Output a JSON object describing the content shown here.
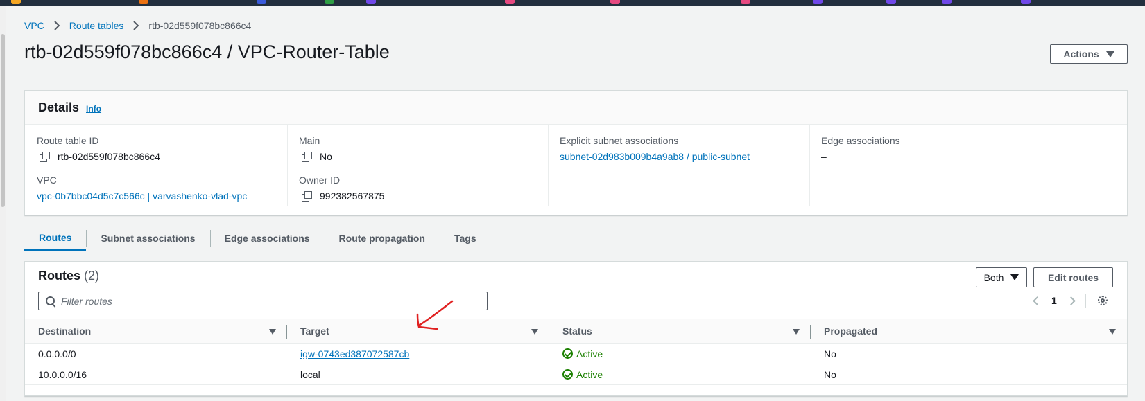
{
  "breadcrumb": {
    "vpc": "VPC",
    "route_tables": "Route tables",
    "current": "rtb-02d559f078bc866c4"
  },
  "page": {
    "title": "rtb-02d559f078bc866c4 / VPC-Router-Table",
    "actions_label": "Actions"
  },
  "details": {
    "heading": "Details",
    "info": "Info",
    "route_table_id_label": "Route table ID",
    "route_table_id": "rtb-02d559f078bc866c4",
    "vpc_label": "VPC",
    "vpc": "vpc-0b7bbc04d5c7c566c | varvashenko-vlad-vpc",
    "main_label": "Main",
    "main": "No",
    "owner_label": "Owner ID",
    "owner": "992382567875",
    "explicit_label": "Explicit subnet associations",
    "explicit": "subnet-02d983b009b4a9ab8 / public-subnet",
    "edge_label": "Edge associations",
    "edge": "–"
  },
  "tabs": [
    "Routes",
    "Subnet associations",
    "Edge associations",
    "Route propagation",
    "Tags"
  ],
  "routes": {
    "title": "Routes",
    "count": "(2)",
    "both_label": "Both",
    "edit_label": "Edit routes",
    "filter_placeholder": "Filter routes",
    "page_number": "1",
    "columns": [
      "Destination",
      "Target",
      "Status",
      "Propagated"
    ],
    "rows": [
      {
        "destination": "0.0.0.0/0",
        "target": "igw-0743ed387072587cb",
        "status": "Active",
        "propagated": "No"
      },
      {
        "destination": "10.0.0.0/16",
        "target": "local",
        "status": "Active",
        "propagated": "No"
      }
    ]
  },
  "colors": {
    "link": "#0073bb",
    "active_status": "#1d8102",
    "annotation": "#e02020",
    "topbar": "#232f3e"
  }
}
